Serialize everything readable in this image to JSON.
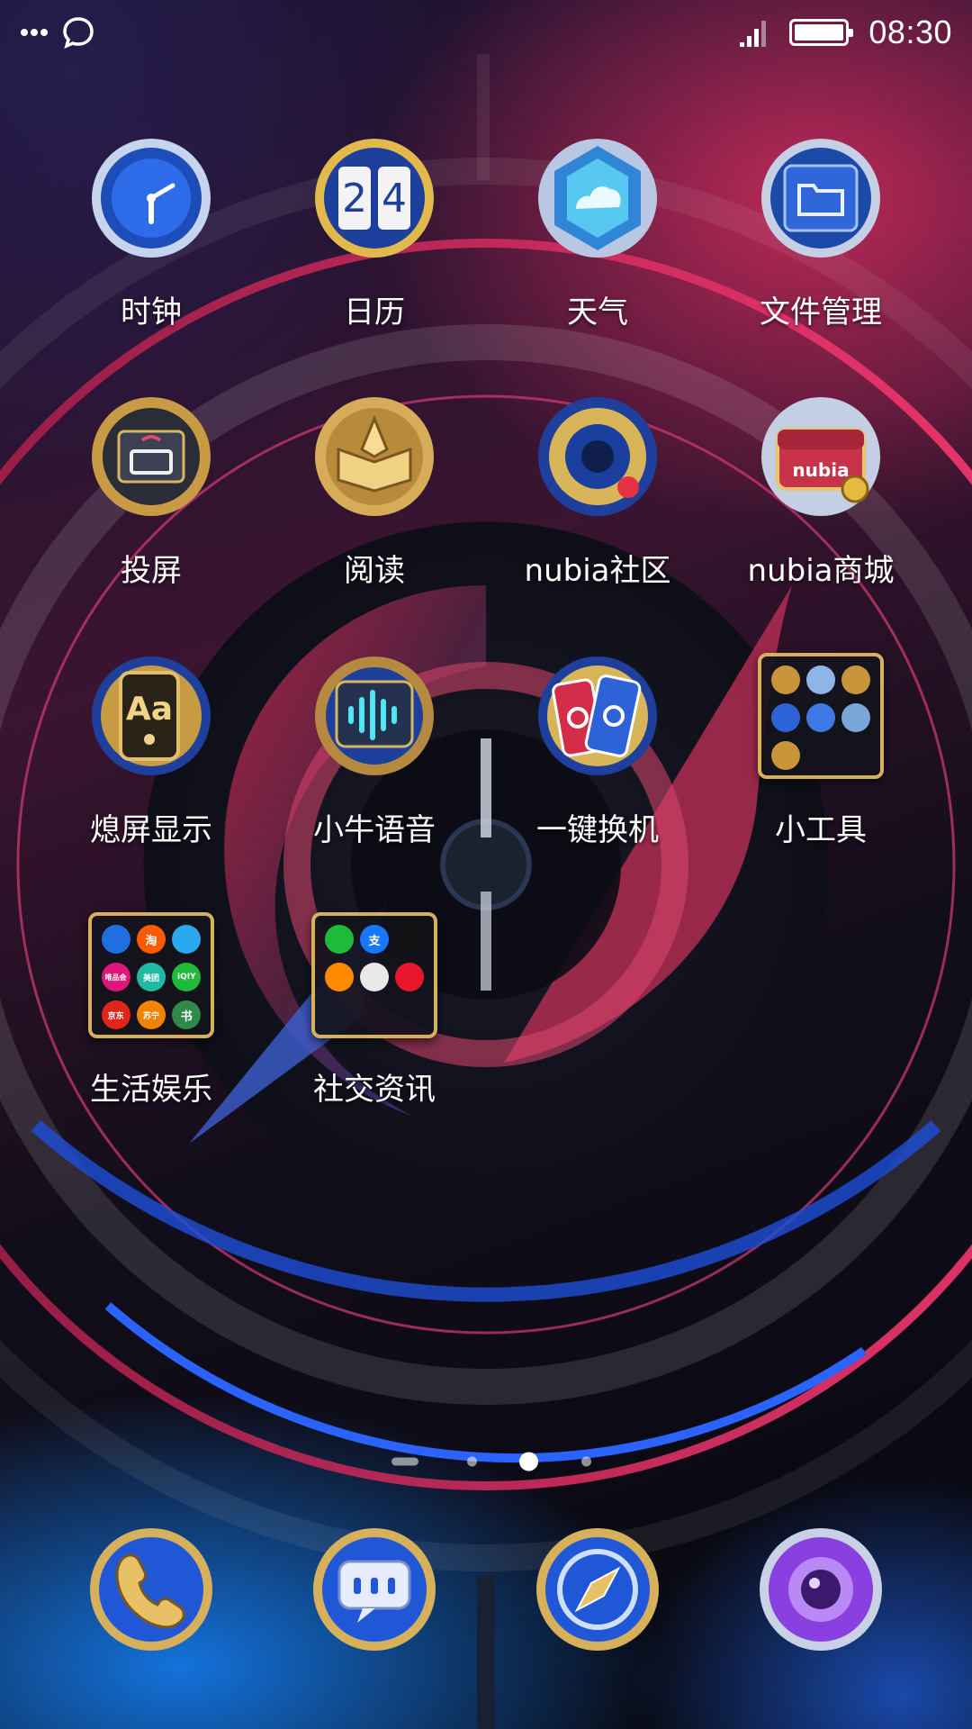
{
  "status_bar": {
    "time": "08:30",
    "left_icons": [
      "more-dots-icon",
      "chat-bubble-icon"
    ],
    "right_icons": [
      "signal-icon",
      "battery-icon"
    ],
    "battery_level": 1.0
  },
  "apps": [
    {
      "label": "时钟",
      "icon": "clock-icon"
    },
    {
      "label": "日历",
      "icon": "calendar-icon",
      "icon_text": [
        "2",
        "4"
      ]
    },
    {
      "label": "天气",
      "icon": "weather-icon"
    },
    {
      "label": "文件管理",
      "icon": "file-manager-icon"
    },
    {
      "label": "投屏",
      "icon": "screen-cast-icon"
    },
    {
      "label": "阅读",
      "icon": "reading-icon"
    },
    {
      "label": "nubia社区",
      "icon": "nubia-community-icon"
    },
    {
      "label": "nubia商城",
      "icon": "nubia-store-icon",
      "icon_text": "nubia"
    },
    {
      "label": "熄屏显示",
      "icon": "ambient-display-icon",
      "icon_text": "Aa"
    },
    {
      "label": "小牛语音",
      "icon": "voice-assistant-icon"
    },
    {
      "label": "一键换机",
      "icon": "phone-clone-icon"
    },
    {
      "label": "小工具",
      "icon": "tools-folder-icon"
    },
    {
      "label": "生活娱乐",
      "icon": "life-entertainment-folder-icon",
      "folder_items": [
        "淘",
        "唯品会",
        "美团",
        "iQIY",
        "京东",
        "苏宁",
        "书"
      ]
    },
    {
      "label": "社交资讯",
      "icon": "social-news-folder-icon",
      "folder_items": [
        "支"
      ]
    }
  ],
  "page_indicator": {
    "count": 4,
    "current": 3
  },
  "dock": [
    {
      "name": "phone",
      "icon": "phone-icon"
    },
    {
      "name": "messages",
      "icon": "message-icon"
    },
    {
      "name": "browser",
      "icon": "compass-icon"
    },
    {
      "name": "camera",
      "icon": "camera-icon"
    }
  ],
  "colors": {
    "gold": "#d6b05a",
    "blue": "#1f5bd6",
    "pink": "#d72d5f",
    "purple": "#8a3fe0"
  }
}
